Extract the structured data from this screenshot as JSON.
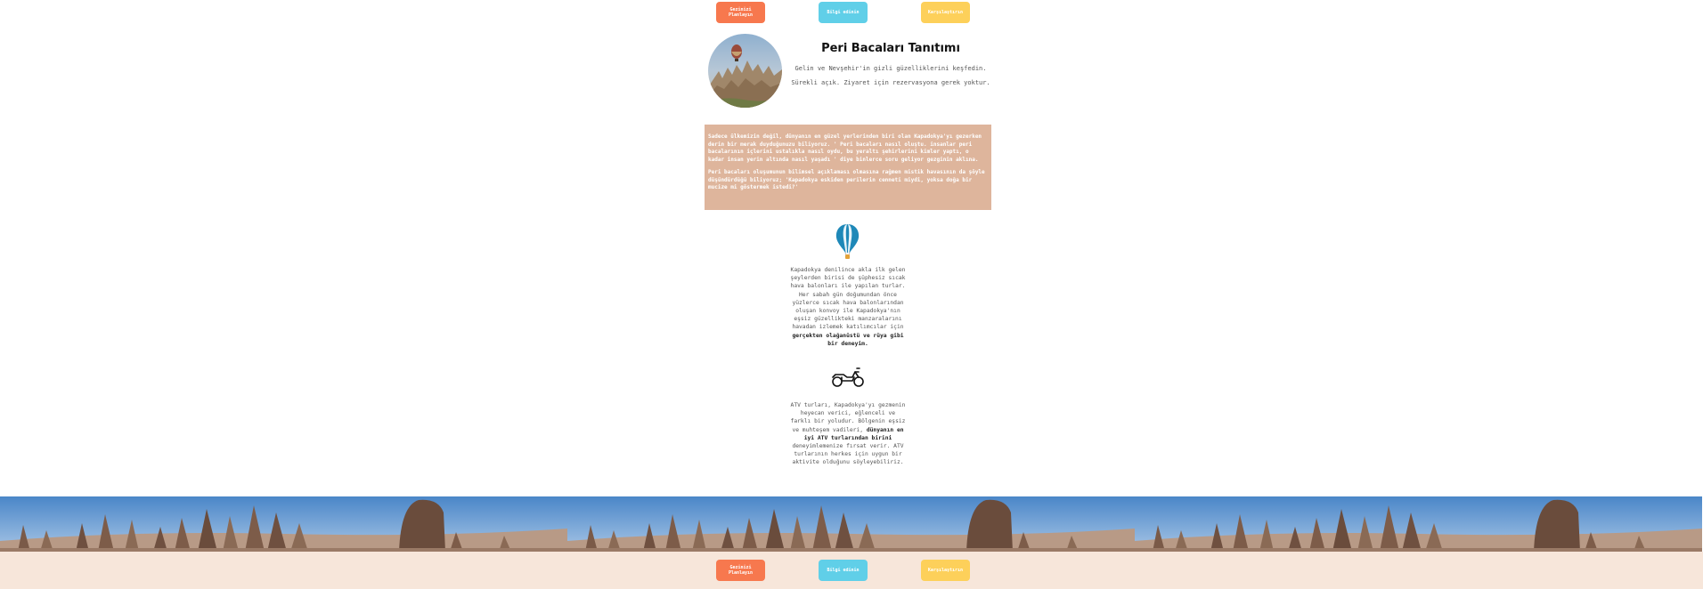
{
  "nav": {
    "btn1": "Gezinizi Planlayın",
    "btn2": "Bilgi edinin",
    "btn3": "Karşılaştırın"
  },
  "header": {
    "title": "Peri Bacaları Tanıtımı",
    "line1": "Gelin ve Nevşehir'in gizli güzelliklerini keşfedin.",
    "line2": "Sürekli açık. Ziyaret için rezervasyona gerek yoktur."
  },
  "intro": {
    "p1": "Sadece ülkemizin değil, dünyanın en güzel yerlerinden biri olan Kapadokya'yı gezerken derin bir merak duyduğunuzu biliyoruz. ' Peri bacaları nasıl oluştu. insanlar peri bacalarının içlerini ustalıkla nasıl oydu, bu yeraltı şehirlerini kimler yaptı, o kadar insan yerin altında nasıl yaşadı ' diye binlerce soru geliyor gezginin aklına.",
    "p2": "Peri bacaları oluşumunun bilimsel açıklaması olmasına rağmen mistik havasının da şöyle düşündürdüğü biliyoruz; 'Kapadokya eskiden perilerin cenneti miydi, yoksa doğa bir mucize mi göstermek istedi?'"
  },
  "feature1": {
    "icon": "hot-air-balloon-icon",
    "text": "Kapadokya denilince akla ilk gelen şeylerden birisi de şüphesiz sıcak hava balonları ile yapılan turlar. Her sabah gün doğumundan önce yüzlerce sıcak hava balonlarından oluşan konvoy ile Kapadokya'nın eşsiz güzellikteki manzaralarını havadan izlemek katılımcılar için ",
    "bold": "gerçekten olağanüstü ve rüya gibi bir deneyim."
  },
  "feature2": {
    "icon": "atv-icon",
    "text1": "ATV turları, Kapadokya'yı gezmenin heyecan verici, eğlenceli ve farklı bir yoludur. Bölgenin eşsiz ve muhteşem vadileri, ",
    "bold": "dünyanın en iyi ATV turlarından birini",
    "text2": " deneyimlemenize fırsat verir. ATV turlarının herkes için uygun bir aktivite olduğunu söyleyebiliriz."
  },
  "footer": {
    "btn1": "Gezinizi Planlayın",
    "btn2": "Bilgi edinin",
    "btn3": "Karşılaştırın"
  },
  "colors": {
    "orange": "#f7784e",
    "blue": "#60cfe8",
    "yellow": "#fdd05a",
    "intro_bg": "#deb59c",
    "footer_bg": "#f7e6da"
  }
}
